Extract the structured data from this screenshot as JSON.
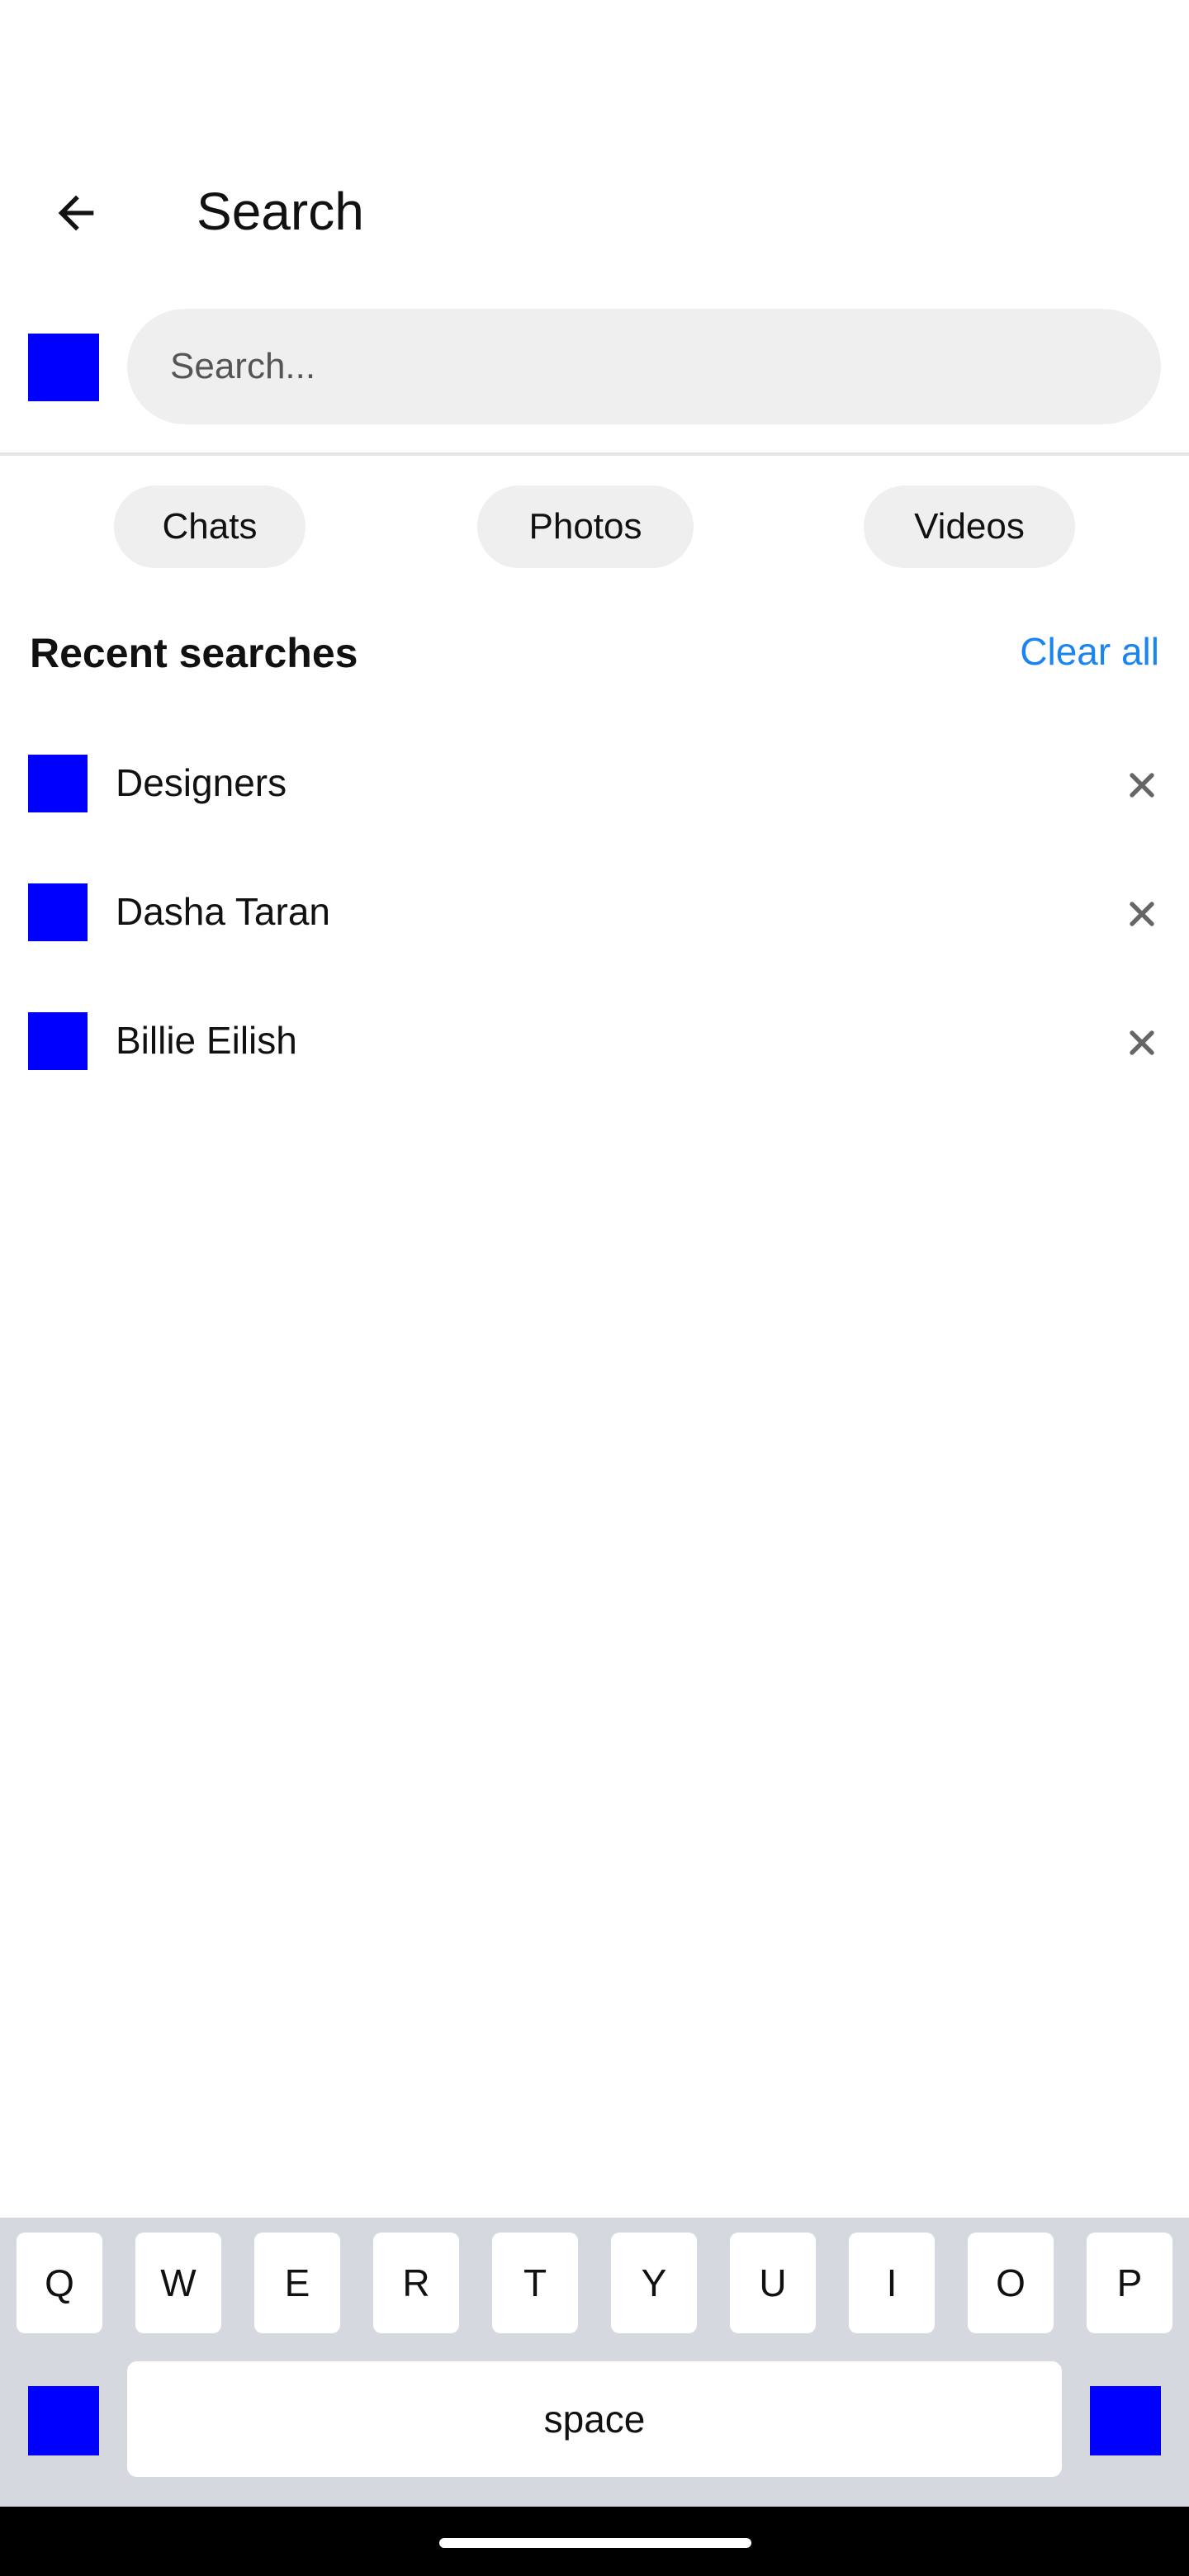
{
  "header": {
    "title": "Search"
  },
  "search": {
    "placeholder": "Search...",
    "value": ""
  },
  "filters": [
    {
      "label": "Chats"
    },
    {
      "label": "Photos"
    },
    {
      "label": "Videos"
    }
  ],
  "recent": {
    "title": "Recent searches",
    "clear_label": "Clear all",
    "items": [
      {
        "label": "Designers"
      },
      {
        "label": "Dasha Taran"
      },
      {
        "label": "Billie Eilish"
      }
    ]
  },
  "keyboard": {
    "keys": [
      "Q",
      "W",
      "E",
      "R",
      "T",
      "Y",
      "U",
      "I",
      "O",
      "P"
    ],
    "space_label": "space"
  },
  "colors": {
    "accent": "#1a85f0",
    "placeholder_square": "#0000ff",
    "chip_bg": "#efefef",
    "keyboard_bg": "#d5d8de"
  },
  "icons": {
    "back": "arrow-left-icon",
    "remove": "close-icon"
  }
}
